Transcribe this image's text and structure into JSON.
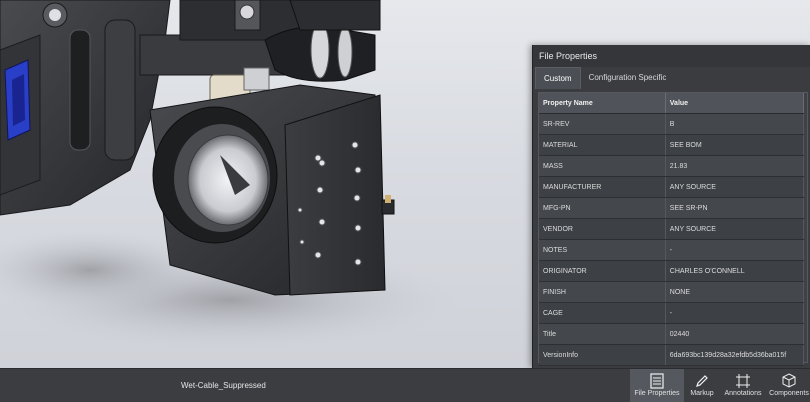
{
  "model": {
    "name": "Wet-Cable_Suppressed"
  },
  "panel": {
    "title": "File Properties",
    "tabs": [
      {
        "label": "Custom",
        "active": true
      },
      {
        "label": "Configuration Specific",
        "active": false
      }
    ],
    "columns": {
      "name": "Property Name",
      "value": "Value"
    },
    "rows": [
      {
        "name": "SR-REV",
        "value": "B"
      },
      {
        "name": "MATERIAL",
        "value": "SEE BOM"
      },
      {
        "name": "MASS",
        "value": "21.83"
      },
      {
        "name": "MANUFACTURER",
        "value": "ANY SOURCE"
      },
      {
        "name": "MFG-PN",
        "value": "SEE SR-PN"
      },
      {
        "name": "VENDOR",
        "value": "ANY SOURCE"
      },
      {
        "name": "NOTES",
        "value": "-"
      },
      {
        "name": "ORIGINATOR",
        "value": "CHARLES O'CONNELL"
      },
      {
        "name": "FINISH",
        "value": "NONE"
      },
      {
        "name": "CAGE",
        "value": "-"
      },
      {
        "name": "Title",
        "value": "02440"
      },
      {
        "name": "VersionInfo",
        "value": "6da693bc139d28a32efdb5d36ba015f"
      }
    ]
  },
  "toolbar": {
    "items": [
      {
        "label": "File Properties",
        "icon": "file-properties-icon",
        "active": true
      },
      {
        "label": "Markup",
        "icon": "pencil-icon",
        "active": false
      },
      {
        "label": "Annotations",
        "icon": "annotations-icon",
        "active": false
      },
      {
        "label": "Components",
        "icon": "components-icon",
        "active": false
      }
    ]
  },
  "colors": {
    "panel_bg": "#3a3c40",
    "statusbar_bg": "#3b3d41",
    "viewport_bg": "#dcdfe4",
    "part_dark": "#2f3033",
    "accent_blue": "#2a3fc8"
  }
}
